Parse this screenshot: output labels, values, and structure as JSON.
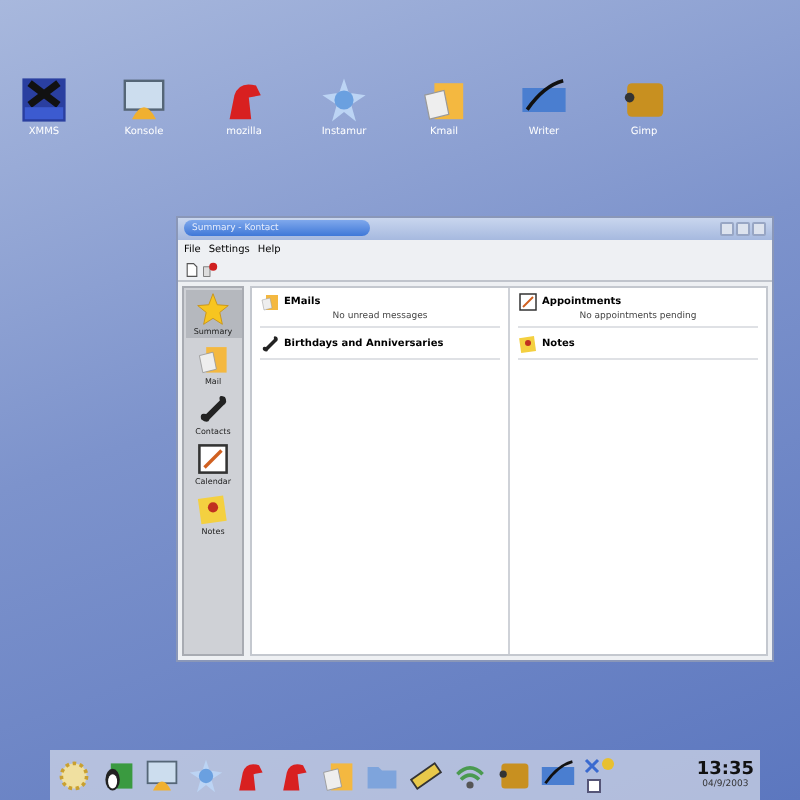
{
  "desktop_icons": [
    {
      "label": "XMMS",
      "kind": "xmms"
    },
    {
      "label": "Konsole",
      "kind": "konsole"
    },
    {
      "label": "mozilla",
      "kind": "mozilla"
    },
    {
      "label": "Instamur",
      "kind": "instamur"
    },
    {
      "label": "Kmail",
      "kind": "kmail"
    },
    {
      "label": "Writer",
      "kind": "writer"
    },
    {
      "label": "Gimp",
      "kind": "gimp"
    }
  ],
  "window": {
    "title": "Summary - Kontact",
    "menu": [
      "File",
      "Settings",
      "Help"
    ],
    "sidebar": {
      "items": [
        {
          "label": "Summary",
          "kind": "star",
          "selected": true
        },
        {
          "label": "Mail",
          "kind": "mail",
          "selected": false
        },
        {
          "label": "Contacts",
          "kind": "phone",
          "selected": false
        },
        {
          "label": "Calendar",
          "kind": "calendar",
          "selected": false
        },
        {
          "label": "Notes",
          "kind": "notes",
          "selected": false
        }
      ]
    },
    "columns": [
      [
        {
          "title": "EMails",
          "kind": "mail",
          "message": "No unread messages"
        },
        {
          "title": "Birthdays and Anniversaries",
          "kind": "phone"
        }
      ],
      [
        {
          "title": "Appointments",
          "kind": "calendar",
          "message": "No appointments pending"
        },
        {
          "title": "Notes",
          "kind": "notes"
        }
      ]
    ]
  },
  "taskbar": {
    "apps": [
      {
        "kind": "kde"
      },
      {
        "kind": "penguin"
      },
      {
        "kind": "konsole"
      },
      {
        "kind": "instamur"
      },
      {
        "kind": "mozilla"
      },
      {
        "kind": "mozilla"
      },
      {
        "kind": "kmail"
      },
      {
        "kind": "folder"
      },
      {
        "kind": "film"
      },
      {
        "kind": "wifi"
      },
      {
        "kind": "gimp"
      },
      {
        "kind": "writer"
      }
    ],
    "time": "13:35",
    "date": "04/9/2003"
  }
}
